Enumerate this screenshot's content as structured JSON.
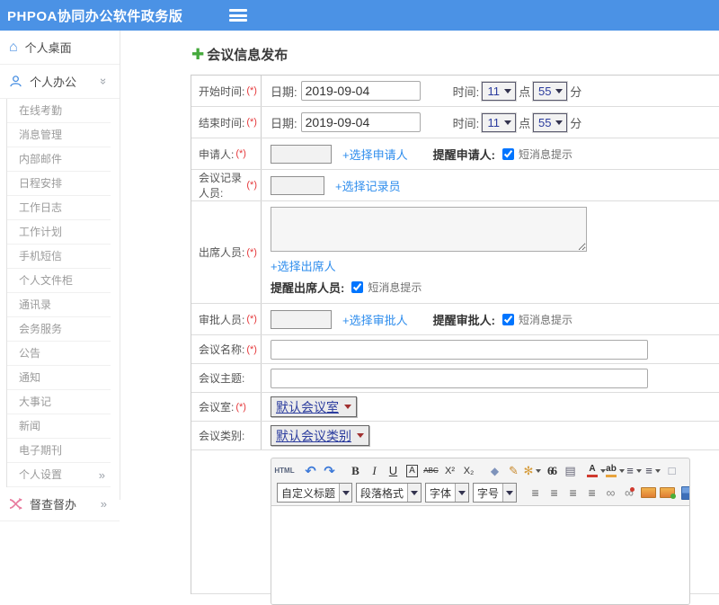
{
  "colors": {
    "header_blue": "#4b92e5",
    "link_blue": "#2e8ded",
    "select_text_blue": "#2b3c9e",
    "required_red": "#e5383b",
    "plus_green": "#45a93c"
  },
  "header": {
    "title": "PHPOA协同办公软件政务版"
  },
  "sidebar": {
    "desktop_label": "个人桌面",
    "office_label": "个人办公",
    "office_items": [
      "在线考勤",
      "消息管理",
      "内部邮件",
      "日程安排",
      "工作日志",
      "工作计划",
      "手机短信",
      "个人文件柜",
      "通讯录",
      "会务服务",
      "公告",
      "通知",
      "大事记",
      "新闻",
      "电子期刊",
      "个人设置"
    ],
    "supervise_label": "督查督办",
    "chevron": "»"
  },
  "form": {
    "title": "会议信息发布",
    "rows": {
      "start_time": {
        "label": "开始时间:",
        "required": "(*)",
        "date_label": "日期:",
        "date_value": "2019-09-04",
        "time_label": "时间:",
        "hour": "11",
        "hour_unit": "点",
        "minute": "55",
        "minute_unit": "分"
      },
      "end_time": {
        "label": "结束时间:",
        "required": "(*)",
        "date_label": "日期:",
        "date_value": "2019-09-04",
        "time_label": "时间:",
        "hour": "11",
        "hour_unit": "点",
        "minute": "55",
        "minute_unit": "分"
      },
      "applicant": {
        "label": "申请人:",
        "required": "(*)",
        "link": "+选择申请人",
        "remind_label": "提醒申请人:",
        "sms_label": "短消息提示"
      },
      "recorder": {
        "label": "会议记录人员:",
        "required": "(*)",
        "link": "+选择记录员"
      },
      "attendees": {
        "label": "出席人员:",
        "required": "(*)",
        "link": "+选择出席人",
        "remind_label": "提醒出席人员:",
        "sms_label": "短消息提示"
      },
      "approver": {
        "label": "审批人员:",
        "required": "(*)",
        "link": "+选择审批人",
        "remind_label": "提醒审批人:",
        "sms_label": "短消息提示"
      },
      "meeting_name": {
        "label": "会议名称:",
        "required": "(*)"
      },
      "meeting_subject": {
        "label": "会议主题:"
      },
      "meeting_room": {
        "label": "会议室:",
        "required": "(*)",
        "value": "默认会议室"
      },
      "meeting_category": {
        "label": "会议类别:",
        "value": "默认会议类别"
      }
    }
  },
  "editor": {
    "selects": {
      "style": "自定义标题",
      "paragraph": "段落格式",
      "font": "字体",
      "size": "字号"
    },
    "icons": {
      "html": "HTML",
      "undo": "↶",
      "redo": "↷",
      "bold": "B",
      "italic": "I",
      "underline": "U",
      "font_frame": "A",
      "strikethrough": "ABC",
      "superscript": "X²",
      "subscript": "X₂",
      "eraser": "◆",
      "brush": "✎",
      "wand": "✻",
      "quote": "66",
      "paste": "▤",
      "font_color": "A",
      "highlight": "ab",
      "ordered_list": "≡",
      "unordered_list": "≡",
      "new_page": "□",
      "align_left": "≡",
      "align_center": "≡",
      "align_right": "≡",
      "justify": "≡",
      "link": "∞",
      "unlink": "∞"
    }
  }
}
